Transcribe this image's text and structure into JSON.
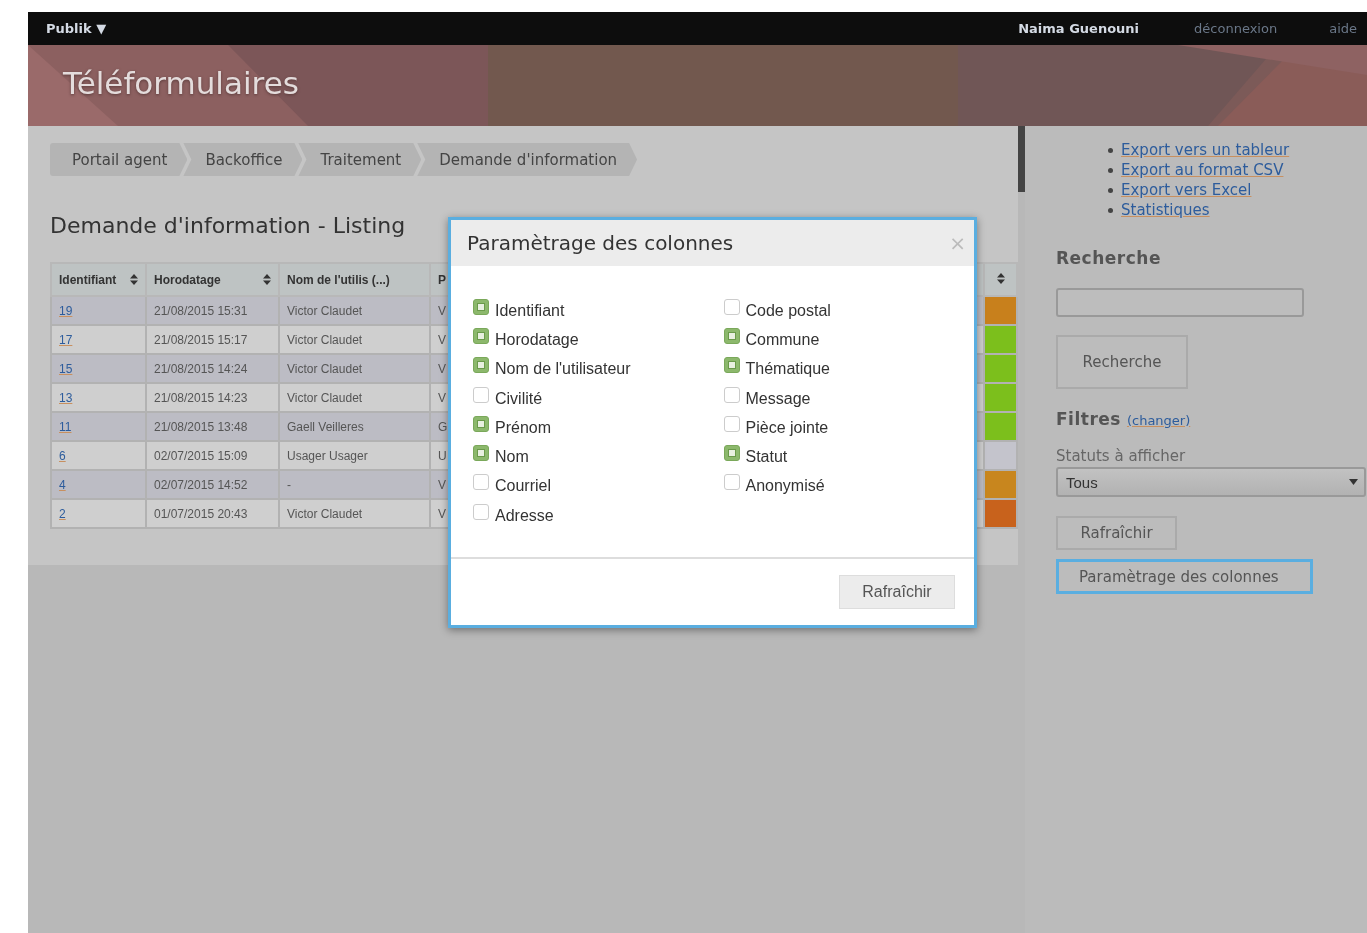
{
  "top_bar": {
    "menu": "Publik ▼",
    "user": "Naima Guenouni",
    "logout": "déconnexion",
    "help": "aide"
  },
  "banner": {
    "title": "Téléformulaires"
  },
  "breadcrumb": [
    "Portail agent",
    "Backoffice",
    "Traitement",
    "Demande d'information"
  ],
  "heading": "Demande d'information - Listing",
  "table": {
    "columns": [
      "Identifiant",
      "Horodatage",
      "Nom de l'utilis (...)",
      "P"
    ],
    "rows": [
      {
        "cells": [
          "19",
          "21/08/2015 15:31",
          "Victor Claudet",
          "V"
        ],
        "color": "#c8801c"
      },
      {
        "cells": [
          "17",
          "21/08/2015 15:17",
          "Victor Claudet",
          "V"
        ],
        "color": "#7cbf1c"
      },
      {
        "cells": [
          "15",
          "21/08/2015 14:24",
          "Victor Claudet",
          "V"
        ],
        "color": "#7cbf1c"
      },
      {
        "cells": [
          "13",
          "21/08/2015 14:23",
          "Victor Claudet",
          "V"
        ],
        "color": "#7cbf1c"
      },
      {
        "cells": [
          "11",
          "21/08/2015 13:48",
          "Gaell Veilleres",
          "G"
        ],
        "color": "#7cbf1c"
      },
      {
        "cells": [
          "6",
          "02/07/2015 15:09",
          "Usager Usager",
          "U"
        ],
        "color": "#c4c4cc"
      },
      {
        "cells": [
          "4",
          "02/07/2015 14:52",
          "-",
          "V"
        ],
        "color": "#c8861e"
      },
      {
        "cells": [
          "2",
          "01/07/2015 20:43",
          "Victor Claudet",
          "V"
        ],
        "color": "#c8621c"
      }
    ]
  },
  "sidebar": {
    "links": [
      "Export vers un tableur",
      "Export au format CSV",
      "Export vers Excel",
      "Statistiques"
    ],
    "search_title": "Recherche",
    "search_button": "Recherche",
    "filters_title": "Filtres",
    "filters_link": "(changer)",
    "status_label": "Statuts à afficher",
    "status_select": "Tous",
    "refresh_button": "Rafraîchir",
    "columns_button": "Paramètrage des colonnes"
  },
  "dialog": {
    "title": "Paramètrage des colonnes",
    "close": "×",
    "columns": [
      [
        {
          "label": "Identifiant",
          "checked": true
        },
        {
          "label": "Horodatage",
          "checked": true
        },
        {
          "label": "Nom de l'utilisateur",
          "checked": true
        },
        {
          "label": "Civilité",
          "checked": false
        },
        {
          "label": "Prénom",
          "checked": true
        },
        {
          "label": "Nom",
          "checked": true
        },
        {
          "label": "Courriel",
          "checked": false
        },
        {
          "label": "Adresse",
          "checked": false
        }
      ],
      [
        {
          "label": "Code postal",
          "checked": false
        },
        {
          "label": "Commune",
          "checked": true
        },
        {
          "label": "Thématique",
          "checked": true
        },
        {
          "label": "Message",
          "checked": false
        },
        {
          "label": "Pièce jointe",
          "checked": false
        },
        {
          "label": "Statut",
          "checked": true
        },
        {
          "label": "Anonymisé",
          "checked": false
        }
      ]
    ],
    "button": "Rafraîchir"
  }
}
